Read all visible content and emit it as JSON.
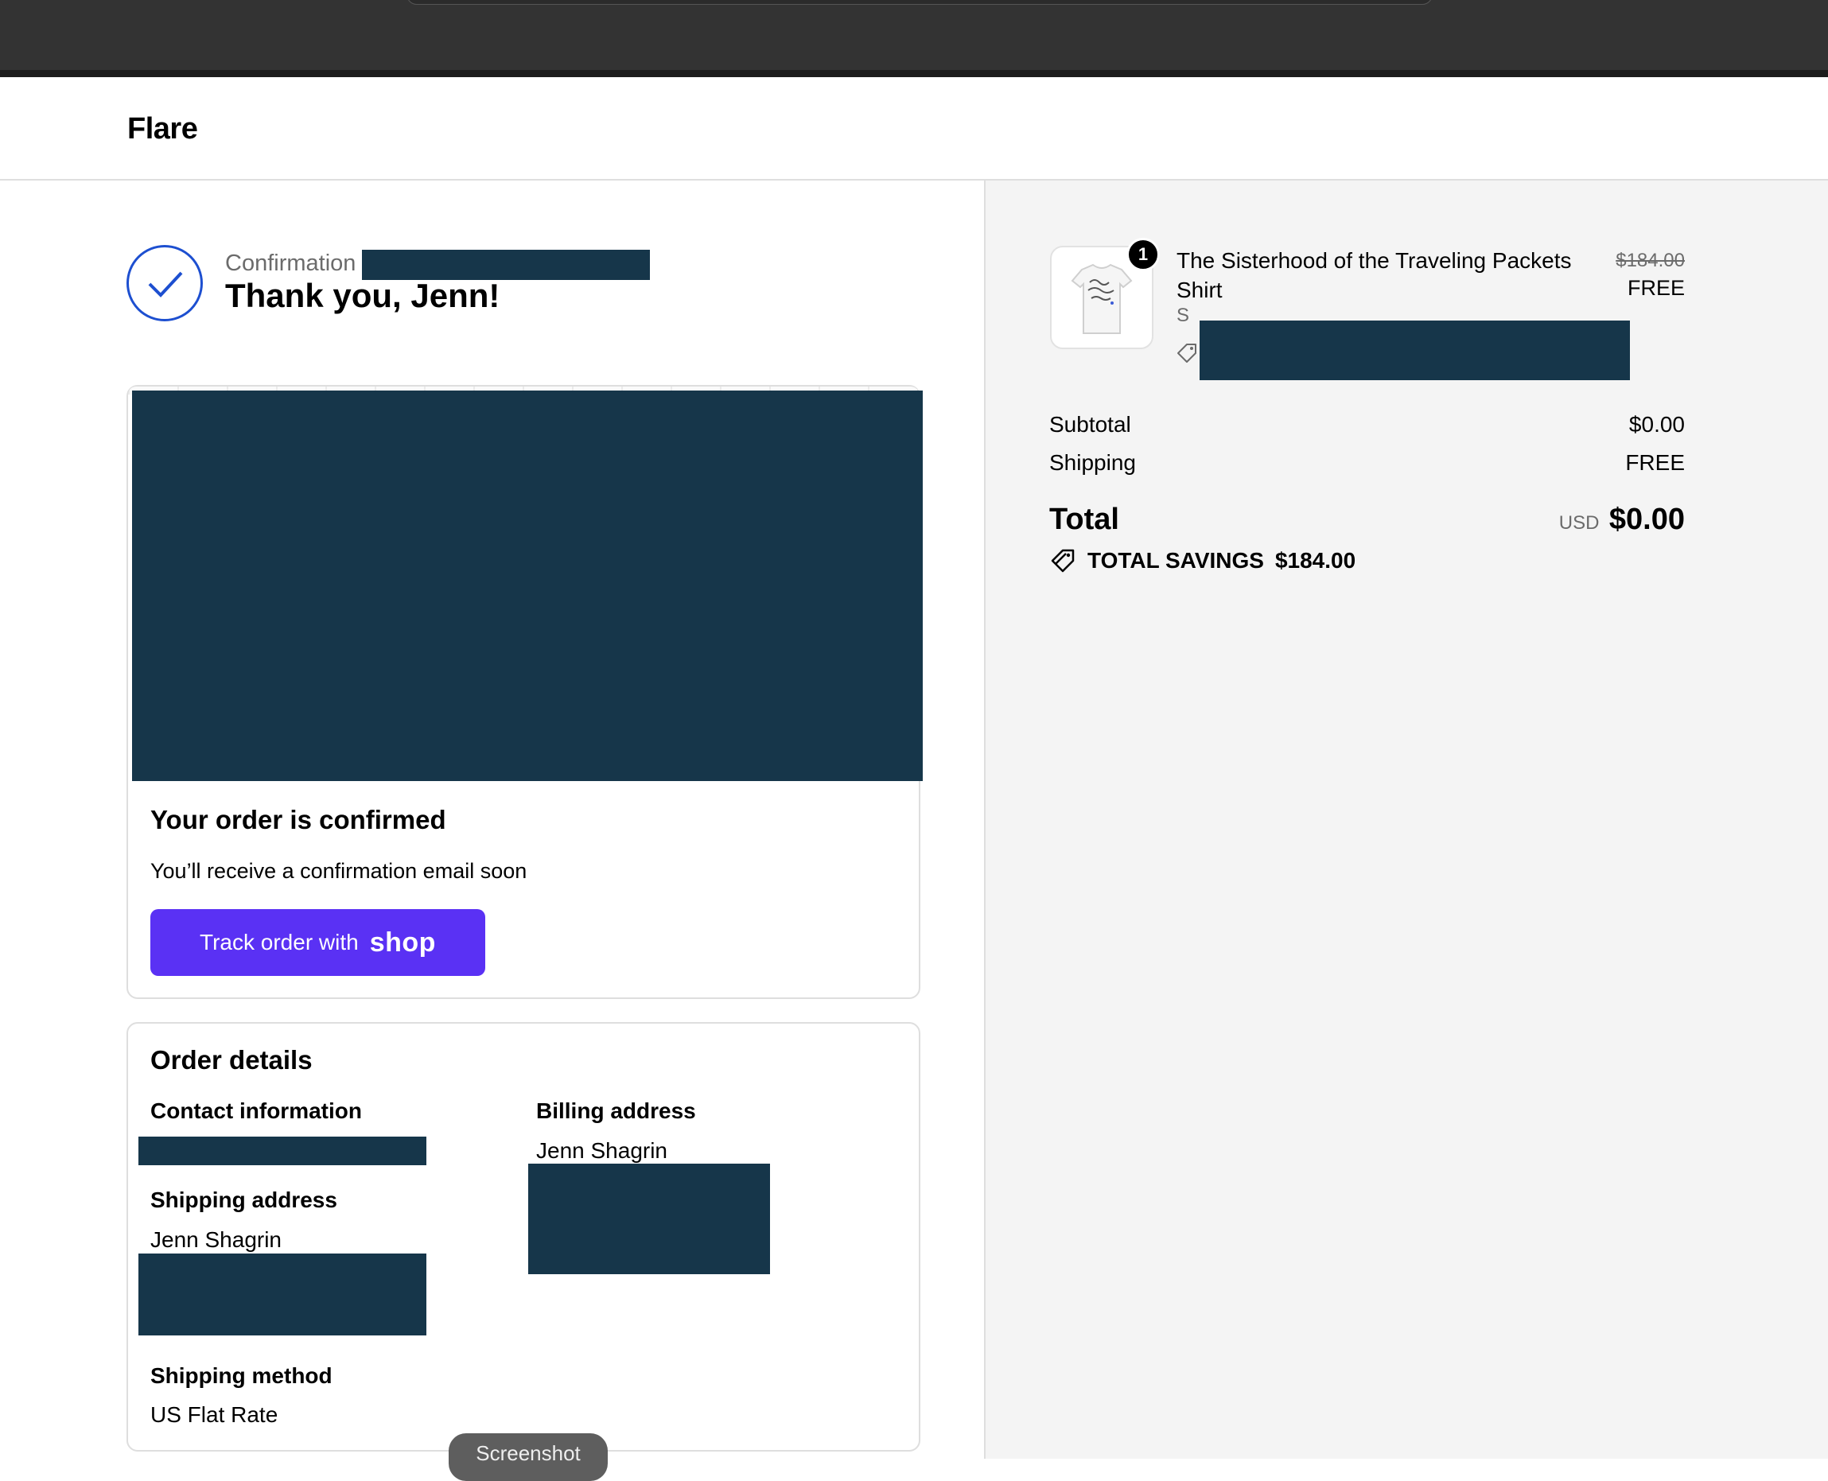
{
  "store": {
    "name": "Flare"
  },
  "confirmation": {
    "label": "Confirmation",
    "greeting": "Thank you, Jenn!"
  },
  "status_card": {
    "title": "Your order is confirmed",
    "message": "You’ll receive a confirmation email soon",
    "track_label": "Track order with",
    "track_brand": "shop"
  },
  "order_details": {
    "title": "Order details",
    "contact_label": "Contact information",
    "shipping_address_label": "Shipping address",
    "shipping_name": "Jenn Shagrin",
    "shipping_method_label": "Shipping method",
    "shipping_method": "US Flat Rate",
    "billing_address_label": "Billing address",
    "billing_name": "Jenn Shagrin"
  },
  "summary": {
    "item": {
      "quantity": "1",
      "name": "The Sisterhood of the Traveling Packets Shirt",
      "variant": "S",
      "original_price": "$184.00",
      "price": "FREE"
    },
    "subtotal_label": "Subtotal",
    "subtotal_value": "$0.00",
    "shipping_label": "Shipping",
    "shipping_value": "FREE",
    "total_label": "Total",
    "currency": "USD",
    "total_value": "$0.00",
    "savings_label": "TOTAL SAVINGS",
    "savings_value": "$184.00"
  },
  "overlay": {
    "toast": "Screenshot"
  },
  "colors": {
    "accent": "#5a31f4",
    "check": "#1d4fd0",
    "redaction": "#16364a"
  }
}
